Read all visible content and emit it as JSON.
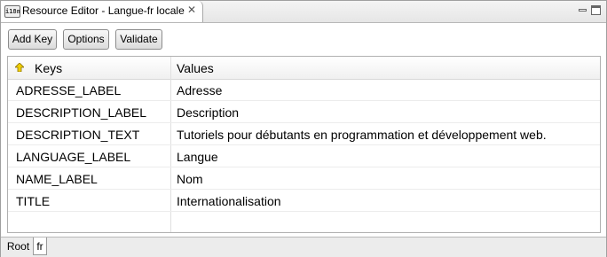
{
  "window": {
    "tab_title": "Resource Editor - Langue-fr locale",
    "tab_icon": "i18n"
  },
  "toolbar": {
    "add_key_label": "Add Key",
    "options_label": "Options",
    "validate_label": "Validate"
  },
  "table": {
    "headers": {
      "keys": "Keys",
      "values": "Values"
    },
    "rows": [
      {
        "key": "ADRESSE_LABEL",
        "value": "Adresse"
      },
      {
        "key": "DESCRIPTION_LABEL",
        "value": "Description"
      },
      {
        "key": "DESCRIPTION_TEXT",
        "value": "Tutoriels pour débutants en programmation et développement web."
      },
      {
        "key": "LANGUAGE_LABEL",
        "value": "Langue"
      },
      {
        "key": "NAME_LABEL",
        "value": "Nom"
      },
      {
        "key": "TITLE",
        "value": "Internationalisation"
      }
    ]
  },
  "locale_tabs": {
    "root": "Root",
    "fr": "fr"
  },
  "colors": {
    "sort_arrow": "#c8a000"
  }
}
